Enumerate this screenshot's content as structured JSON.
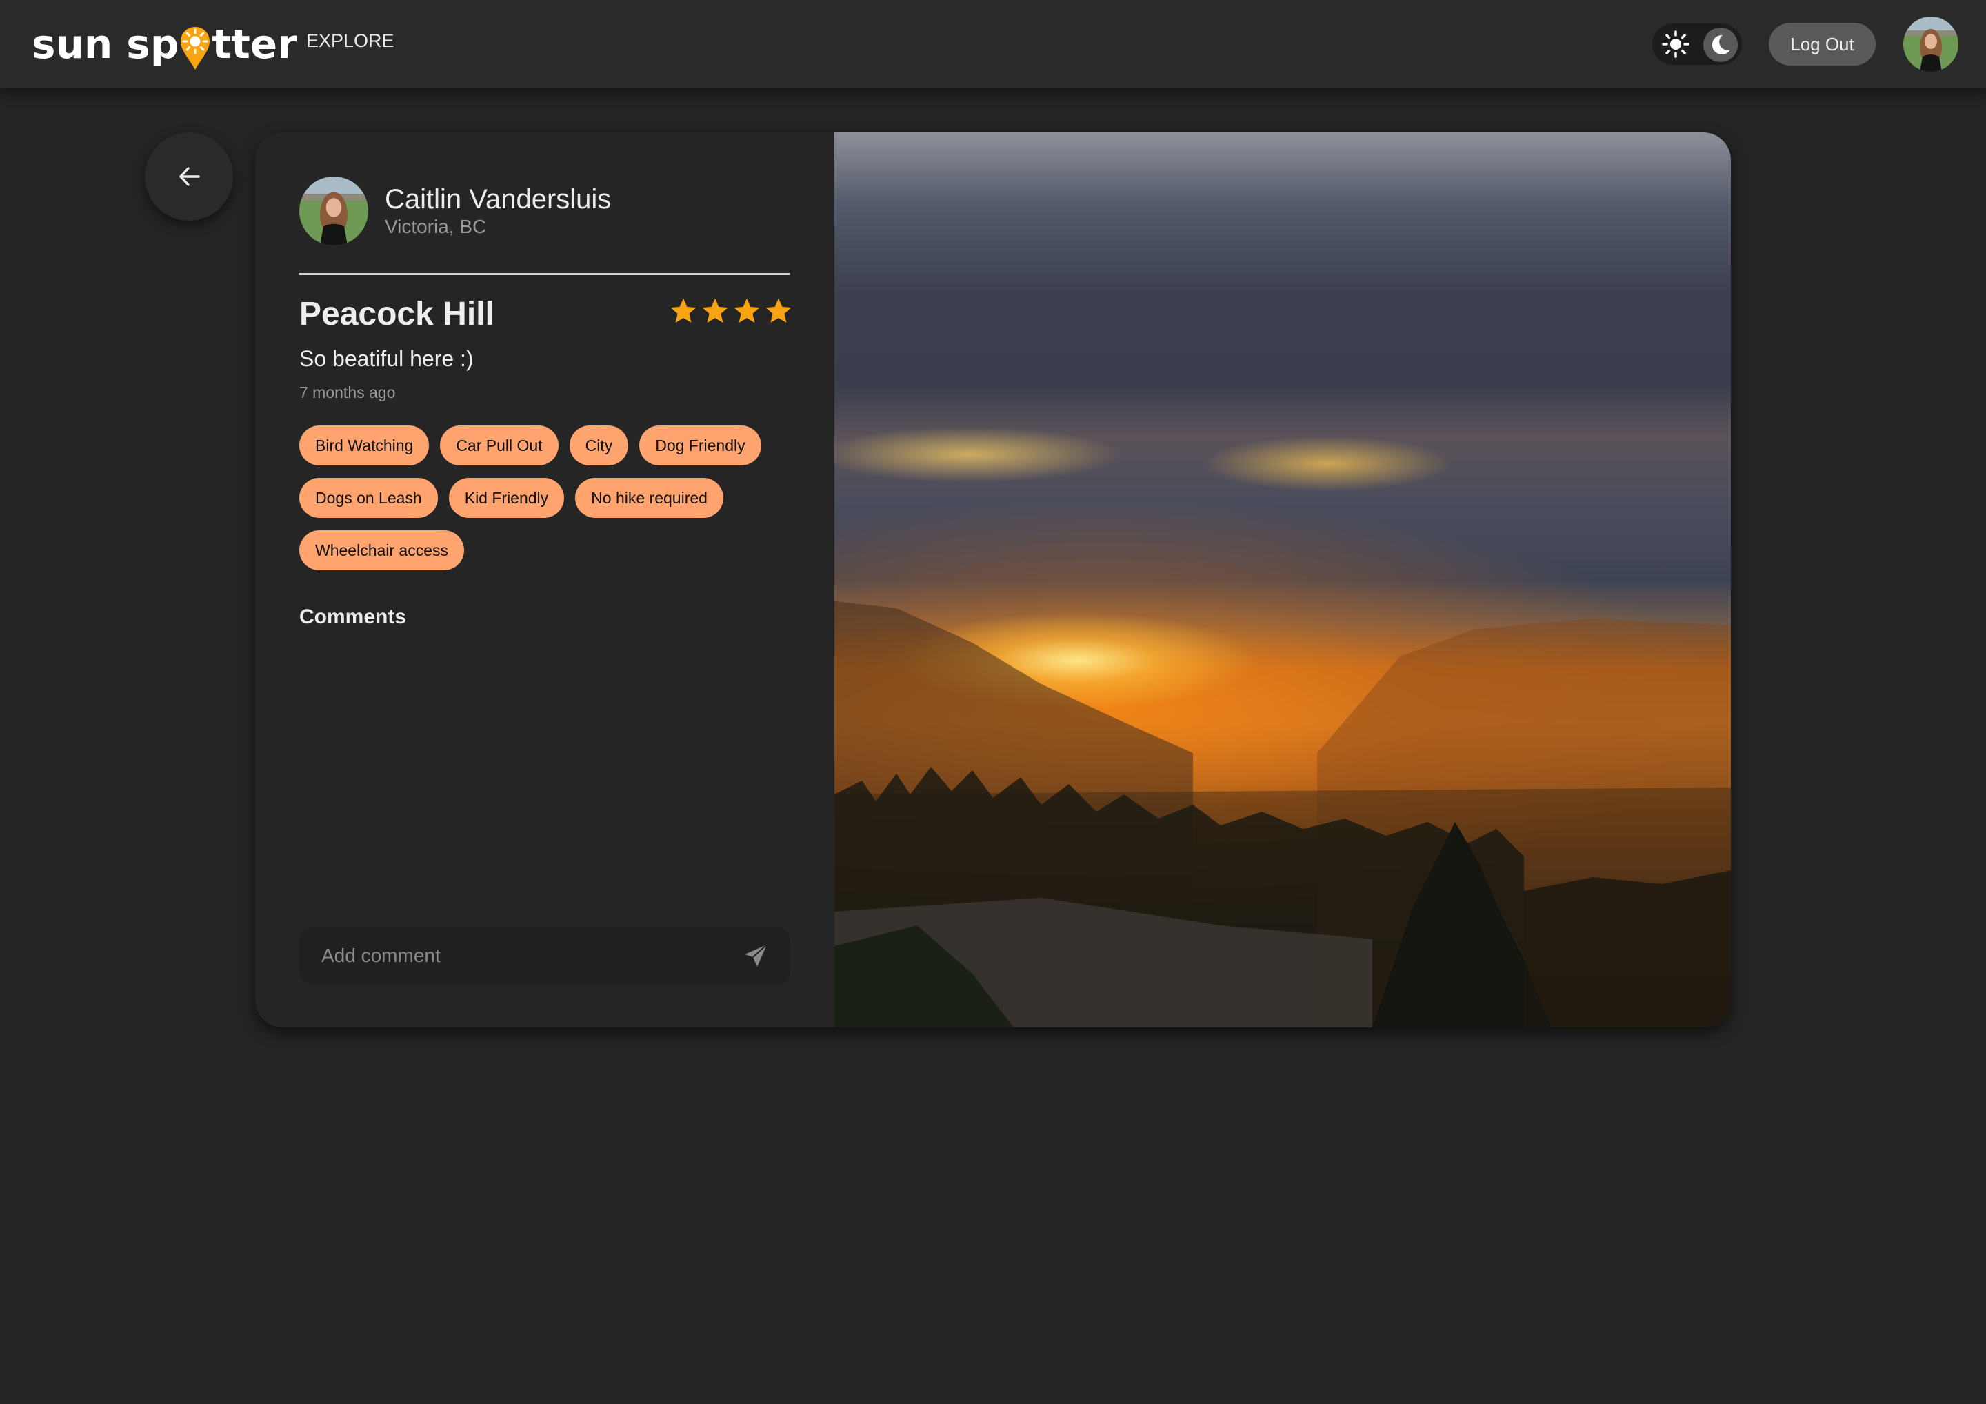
{
  "header": {
    "logo_text_left": "sun sp",
    "logo_text_right": "tter",
    "logo_icon": "sun-pin-icon",
    "nav": [
      {
        "label": "EXPLORE"
      }
    ],
    "theme_toggle": {
      "options": [
        "light",
        "dark"
      ],
      "selected": "dark"
    },
    "logout_label": "Log Out",
    "avatar": "user-avatar"
  },
  "back_button": {
    "icon": "arrow-left-icon"
  },
  "post": {
    "author": {
      "name": "Caitlin Vandersluis",
      "location": "Victoria, BC"
    },
    "title": "Peacock Hill",
    "rating": 4,
    "description": "So beatiful here :)",
    "time": "7 months ago",
    "tags": [
      {
        "label": "Bird Watching"
      },
      {
        "label": "Car Pull Out"
      },
      {
        "label": "City"
      },
      {
        "label": "Dog Friendly"
      },
      {
        "label": "Dogs on Leash"
      },
      {
        "label": "Kid Friendly"
      },
      {
        "label": "No hike required"
      },
      {
        "label": "Wheelchair access"
      }
    ],
    "comments_label": "Comments",
    "comments": [],
    "comment_input": {
      "value": "",
      "placeholder": "Add comment"
    },
    "photo": "sunset-over-valley-photo"
  },
  "colors": {
    "accent": "#F9A513",
    "tag_bg": "#FFA36F",
    "page_bg": "#242424",
    "header_bg": "#2A2A2A",
    "card_bg": "#252525"
  }
}
